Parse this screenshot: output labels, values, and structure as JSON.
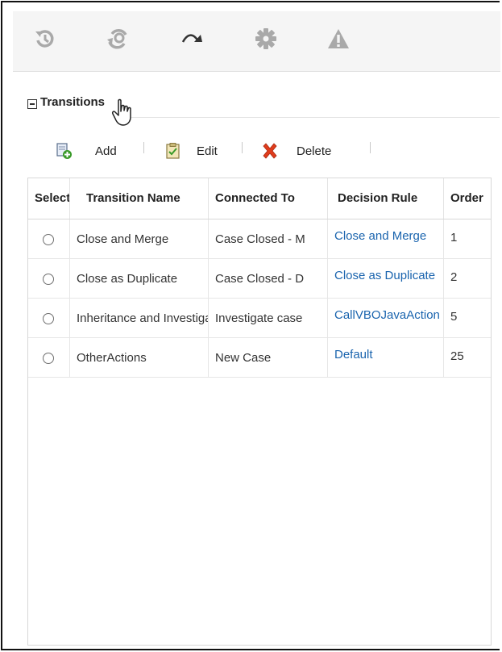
{
  "toolbar": {
    "icons": [
      "history-icon",
      "refresh-settings-icon",
      "transition-arrow-icon",
      "gear-icon",
      "warning-icon"
    ]
  },
  "section": {
    "title": "Transitions"
  },
  "actions": {
    "add": "Add",
    "edit": "Edit",
    "delete": "Delete"
  },
  "table": {
    "columns": [
      "Select",
      "Transition Name",
      "Connected To",
      "Decision Rule",
      "Order"
    ],
    "rows": [
      {
        "name": "Close and Merge",
        "connected": "Case Closed - M",
        "rule": "Close and Merge",
        "order": "1"
      },
      {
        "name": "Close as Duplicate",
        "connected": "Case Closed - D",
        "rule": "Close as Duplicate",
        "order": "2"
      },
      {
        "name": "Inheritance and Investigation",
        "connected": "Investigate case",
        "rule": "CallVBOJavaAction",
        "order": "5"
      },
      {
        "name": "OtherActions",
        "connected": "New Case",
        "rule": "Default",
        "order": "25"
      }
    ]
  },
  "colors": {
    "link": "#1a64ae",
    "toolbar_bg": "#f5f5f5",
    "delete_red": "#e03c1c",
    "add_green": "#3a9a2a"
  }
}
